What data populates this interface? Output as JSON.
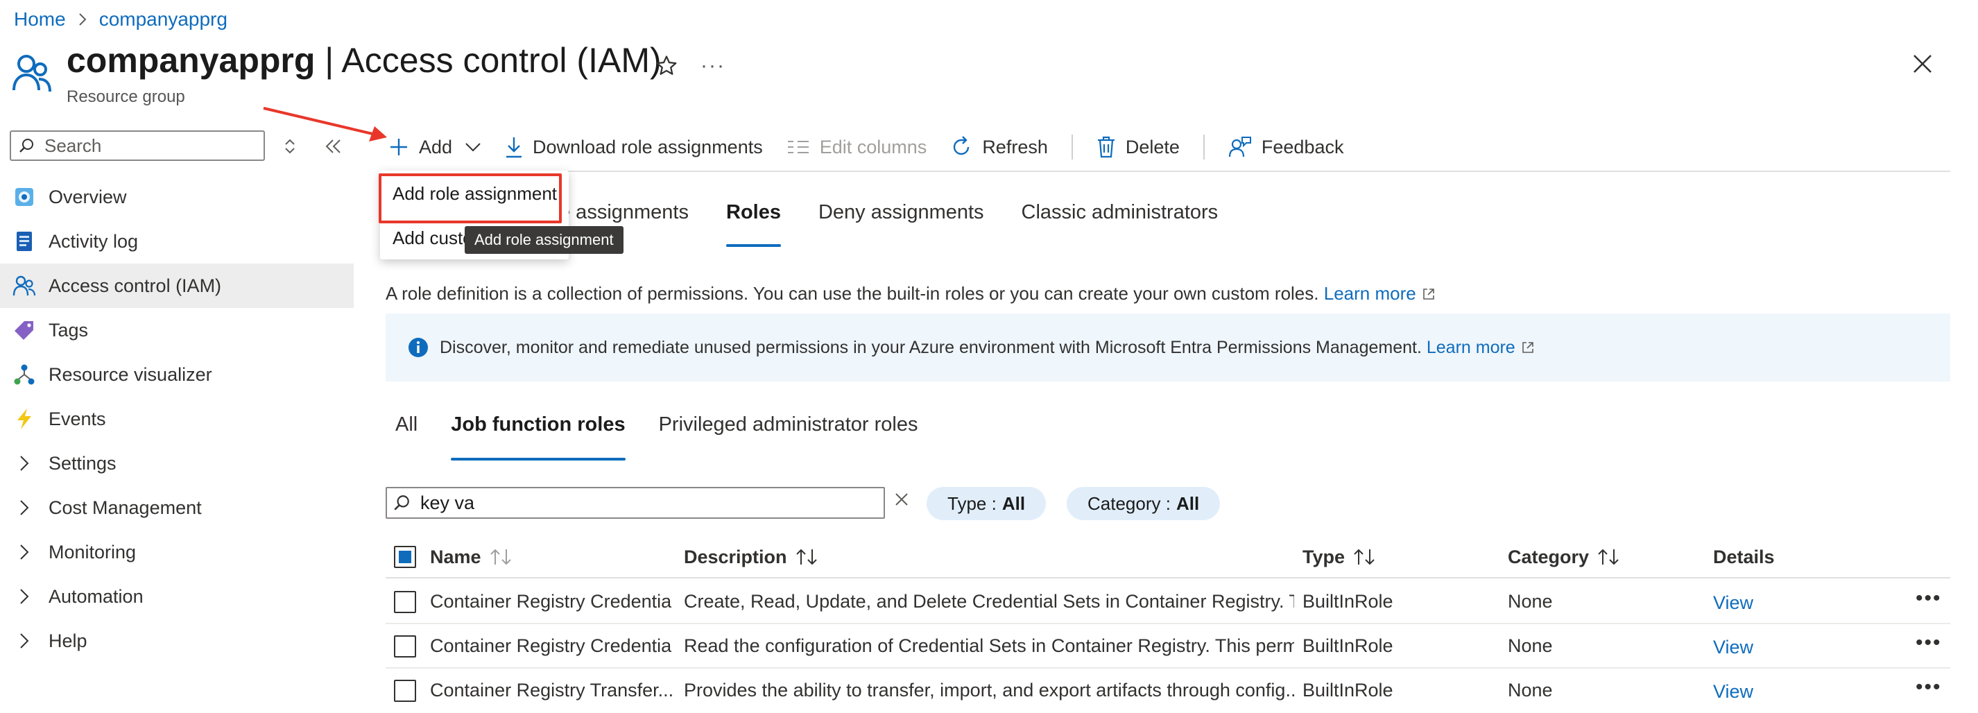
{
  "breadcrumb": {
    "home": "Home",
    "current": "companyapprg"
  },
  "header": {
    "title_bold": "companyapprg",
    "title_rest": " | Access control (IAM)",
    "subtitle": "Resource group",
    "more": "···"
  },
  "sidebar": {
    "search_placeholder": "Search",
    "items": [
      {
        "label": "Overview",
        "icon": "overview-icon"
      },
      {
        "label": "Activity log",
        "icon": "activity-log-icon"
      },
      {
        "label": "Access control (IAM)",
        "icon": "iam-icon",
        "selected": true
      },
      {
        "label": "Tags",
        "icon": "tag-icon"
      },
      {
        "label": "Resource visualizer",
        "icon": "resource-visualizer-icon"
      },
      {
        "label": "Events",
        "icon": "events-bolt-icon"
      },
      {
        "label": "Settings",
        "icon": "chevron-right-icon"
      },
      {
        "label": "Cost Management",
        "icon": "chevron-right-icon"
      },
      {
        "label": "Monitoring",
        "icon": "chevron-right-icon"
      },
      {
        "label": "Automation",
        "icon": "chevron-right-icon"
      },
      {
        "label": "Help",
        "icon": "chevron-right-icon"
      }
    ]
  },
  "toolbar": {
    "add": "Add",
    "download": "Download role assignments",
    "edit_columns": "Edit columns",
    "refresh": "Refresh",
    "delete": "Delete",
    "feedback": "Feedback"
  },
  "tabs": {
    "role_assignments_partial": "e assignments",
    "roles": "Roles",
    "deny": "Deny assignments",
    "classic": "Classic administrators"
  },
  "dropdown": {
    "add_role_assignment": "Add role assignment",
    "add_custom_partial": "Add custo",
    "tooltip": "Add role assignment"
  },
  "description": {
    "text": "A role definition is a collection of permissions. You can use the built-in roles or you can create your own custom roles.",
    "learn_more": "Learn more"
  },
  "info_banner": {
    "text": "Discover, monitor and remediate unused permissions in your Azure environment with Microsoft Entra Permissions Management.",
    "learn_more": "Learn more"
  },
  "subtabs": {
    "all": "All",
    "job": "Job function roles",
    "privileged": "Privileged administrator roles"
  },
  "filter": {
    "search_value": "key va",
    "type_label": "Type :",
    "type_value": "All",
    "category_label": "Category :",
    "category_value": "All"
  },
  "table": {
    "headers": {
      "name": "Name",
      "description": "Description",
      "type": "Type",
      "category": "Category",
      "details": "Details"
    },
    "rows": [
      {
        "name": "Container Registry Credentia...",
        "description": "Create, Read, Update, and Delete Credential Sets in Container Registry. Thi...",
        "type": "BuiltInRole",
        "category": "None",
        "details": "View",
        "more": "•••"
      },
      {
        "name": "Container Registry Credentia...",
        "description": "Read the configuration of Credential Sets in Container Registry. This permi...",
        "type": "BuiltInRole",
        "category": "None",
        "details": "View",
        "more": "•••"
      },
      {
        "name": "Container Registry Transfer...",
        "description": "Provides the ability to transfer, import, and export artifacts through config...",
        "type": "BuiltInRole",
        "category": "None",
        "details": "View",
        "more": "•••"
      }
    ]
  },
  "colors": {
    "accent": "#0f6cbd",
    "highlight": "#e8372a",
    "banner": "#eff6fc",
    "pill": "#e1eefa"
  }
}
